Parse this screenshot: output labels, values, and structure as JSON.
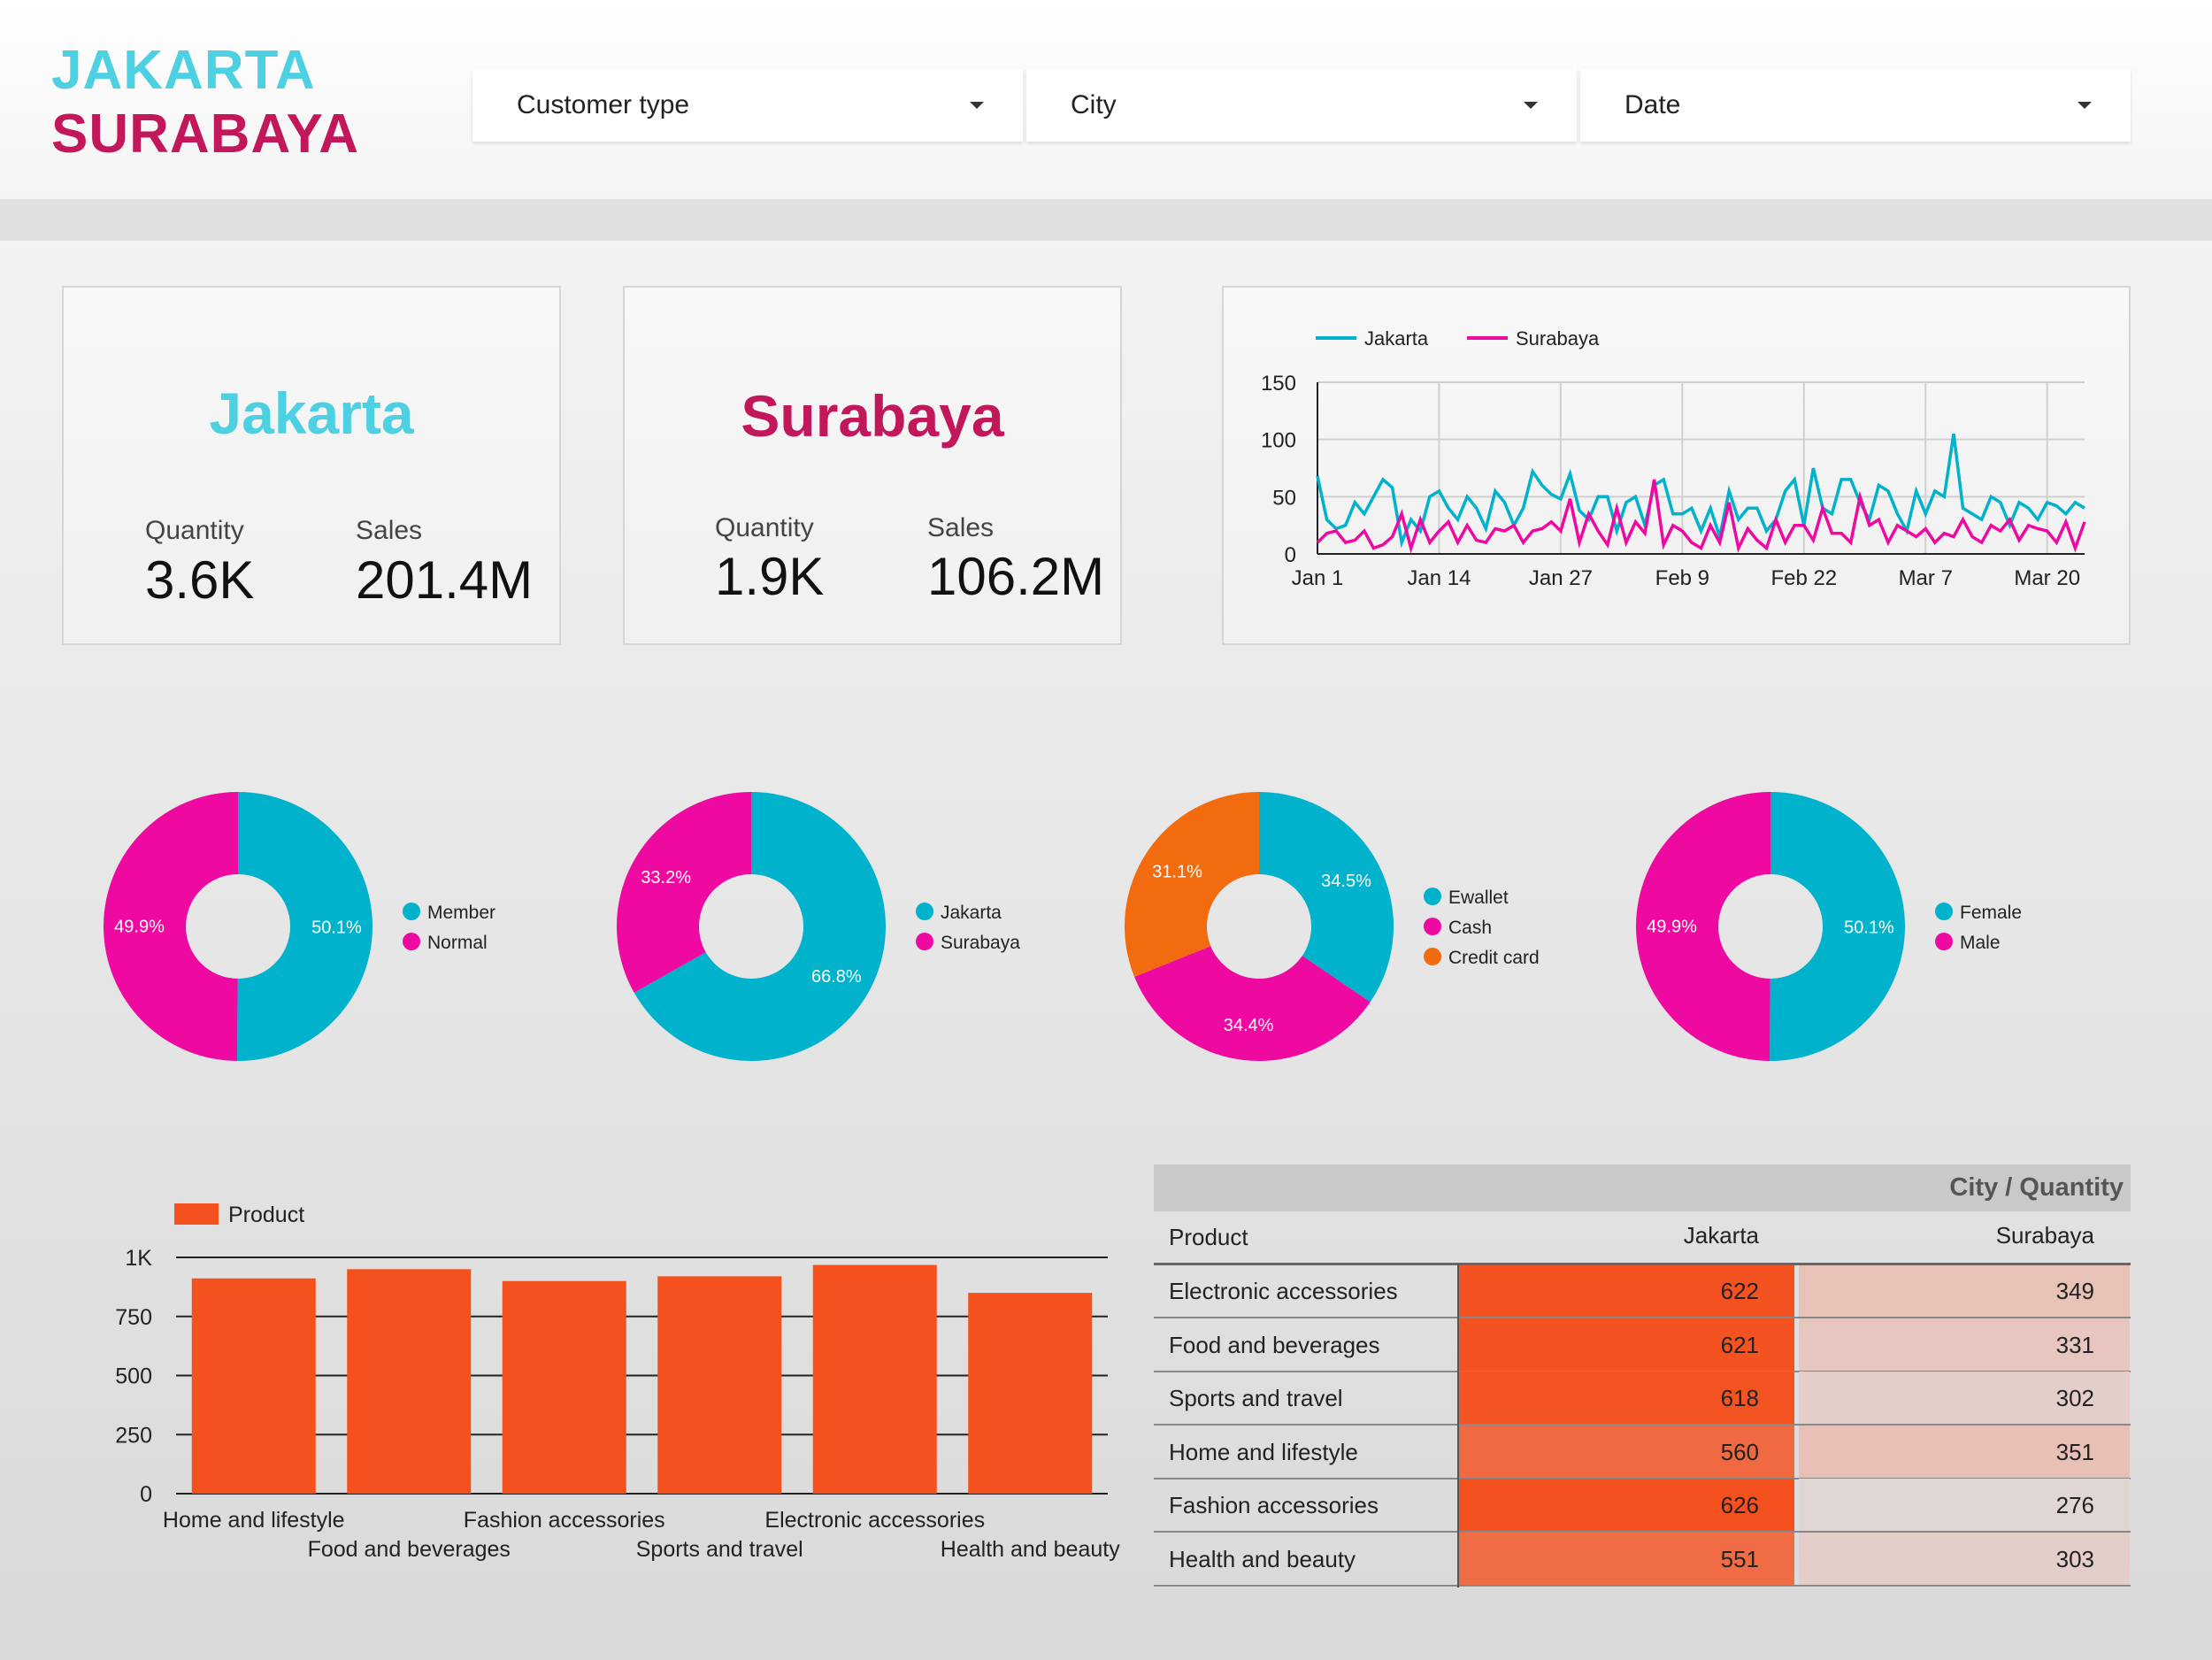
{
  "header": {
    "title_line1": "JAKARTA",
    "title_line2": "SURABAYA",
    "filters": [
      {
        "label": "Customer type"
      },
      {
        "label": "City"
      },
      {
        "label": "Date"
      }
    ]
  },
  "scorecards": [
    {
      "city": "Jakarta",
      "city_color": "#4dd0e1",
      "quantity_label": "Quantity",
      "quantity": "3.6K",
      "sales_label": "Sales",
      "sales": "201.4M"
    },
    {
      "city": "Surabaya",
      "city_color": "#c2185b",
      "quantity_label": "Quantity",
      "quantity": "1.9K",
      "sales_label": "Sales",
      "sales": "106.2M"
    }
  ],
  "colors": {
    "cyan": "#00b2cc",
    "magenta": "#ee0aa0",
    "orange": "#f26b0f",
    "bar": "#f4511e"
  },
  "chart_data": [
    {
      "type": "line",
      "x_ticks": [
        "Jan 1",
        "Jan 14",
        "Jan 27",
        "Feb 9",
        "Feb 22",
        "Mar 7",
        "Mar 20"
      ],
      "ylim": [
        0,
        150
      ],
      "y_ticks": [
        0,
        50,
        100,
        150
      ],
      "legend": "top-left",
      "grid": true,
      "series": [
        {
          "name": "Jakarta",
          "color": "#00b2cc",
          "values": [
            68,
            30,
            22,
            25,
            45,
            35,
            50,
            65,
            58,
            10,
            30,
            20,
            50,
            55,
            40,
            30,
            50,
            40,
            22,
            55,
            45,
            25,
            40,
            72,
            60,
            52,
            48,
            70,
            38,
            30,
            50,
            50,
            20,
            45,
            50,
            25,
            60,
            65,
            35,
            35,
            40,
            20,
            40,
            15,
            55,
            30,
            40,
            40,
            20,
            30,
            55,
            65,
            25,
            75,
            40,
            35,
            65,
            65,
            45,
            30,
            60,
            55,
            35,
            20,
            55,
            35,
            55,
            50,
            105,
            40,
            35,
            30,
            50,
            45,
            25,
            45,
            40,
            30,
            45,
            42,
            35,
            45,
            40
          ]
        },
        {
          "name": "Surabaya",
          "color": "#ee0aa0",
          "values": [
            10,
            18,
            20,
            10,
            12,
            20,
            5,
            8,
            15,
            35,
            5,
            30,
            10,
            20,
            28,
            10,
            25,
            12,
            10,
            22,
            20,
            25,
            10,
            20,
            22,
            28,
            20,
            48,
            10,
            35,
            20,
            8,
            40,
            10,
            28,
            18,
            65,
            8,
            25,
            20,
            10,
            5,
            25,
            10,
            45,
            5,
            22,
            12,
            5,
            30,
            10,
            25,
            25,
            12,
            40,
            18,
            18,
            10,
            50,
            25,
            30,
            10,
            25,
            20,
            15,
            22,
            10,
            18,
            15,
            30,
            15,
            10,
            25,
            20,
            30,
            12,
            25,
            22,
            20,
            10,
            28,
            5,
            28
          ]
        }
      ]
    },
    {
      "type": "pie",
      "donut": true,
      "legend": "right",
      "slices": [
        {
          "label": "Member",
          "value": 50.1,
          "color": "#00b2cc"
        },
        {
          "label": "Normal",
          "value": 49.9,
          "color": "#ee0aa0"
        }
      ]
    },
    {
      "type": "pie",
      "donut": true,
      "legend": "right",
      "slices": [
        {
          "label": "Jakarta",
          "value": 66.8,
          "color": "#00b2cc"
        },
        {
          "label": "Surabaya",
          "value": 33.2,
          "color": "#ee0aa0"
        }
      ]
    },
    {
      "type": "pie",
      "donut": true,
      "legend": "right",
      "slices": [
        {
          "label": "Ewallet",
          "value": 34.5,
          "color": "#00b2cc"
        },
        {
          "label": "Cash",
          "value": 34.4,
          "color": "#ee0aa0"
        },
        {
          "label": "Credit card",
          "value": 31.1,
          "color": "#f26b0f"
        }
      ]
    },
    {
      "type": "pie",
      "donut": true,
      "legend": "right",
      "slices": [
        {
          "label": "Female",
          "value": 50.1,
          "color": "#00b2cc"
        },
        {
          "label": "Male",
          "value": 49.9,
          "color": "#ee0aa0"
        }
      ]
    },
    {
      "type": "bar",
      "legend": "top-left",
      "series": [
        {
          "name": "Product",
          "color": "#f4511e",
          "values": [
            911,
            950,
            900,
            920,
            968,
            850
          ]
        }
      ],
      "categories": [
        "Home and lifestyle",
        "Food and beverages",
        "Fashion accessories",
        "Sports and travel",
        "Electronic accessories",
        "Health and beauty"
      ],
      "ylim": [
        0,
        1000
      ],
      "y_tick_labels": [
        "0",
        "250",
        "500",
        "750",
        "1K"
      ]
    },
    {
      "type": "table",
      "title": "City / Quantity",
      "columns": [
        "Product",
        "Jakarta",
        "Surabaya"
      ],
      "rows": [
        {
          "product": "Electronic accessories",
          "jakarta": 622,
          "surabaya": 349
        },
        {
          "product": "Food and beverages",
          "jakarta": 621,
          "surabaya": 331
        },
        {
          "product": "Sports and travel",
          "jakarta": 618,
          "surabaya": 302
        },
        {
          "product": "Home and lifestyle",
          "jakarta": 560,
          "surabaya": 351
        },
        {
          "product": "Fashion accessories",
          "jakarta": 626,
          "surabaya": 276
        },
        {
          "product": "Health and beauty",
          "jakarta": 551,
          "surabaya": 303
        }
      ]
    }
  ]
}
